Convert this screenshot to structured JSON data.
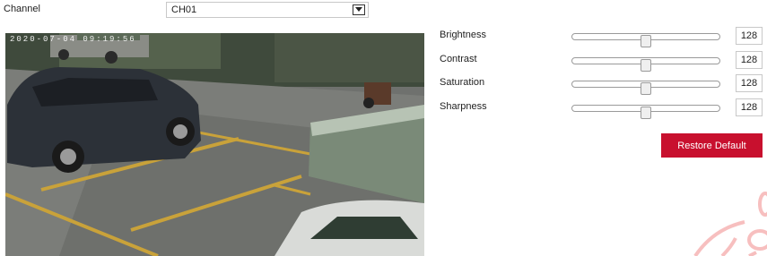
{
  "channel": {
    "label": "Channel",
    "selected": "CH01"
  },
  "video": {
    "osd_timestamp": "2020-07-04  09:19:56"
  },
  "adjustments": [
    {
      "label": "Brightness",
      "value": "128",
      "level": 128
    },
    {
      "label": "Contrast",
      "value": "128",
      "level": 128
    },
    {
      "label": "Saturation",
      "value": "128",
      "level": 128
    },
    {
      "label": "Sharpness",
      "value": "128",
      "level": 128
    }
  ],
  "slider_max": 255,
  "restore_label": "Restore Default",
  "colors": {
    "accent": "#c8102e",
    "watermark": "#f08a8a"
  }
}
